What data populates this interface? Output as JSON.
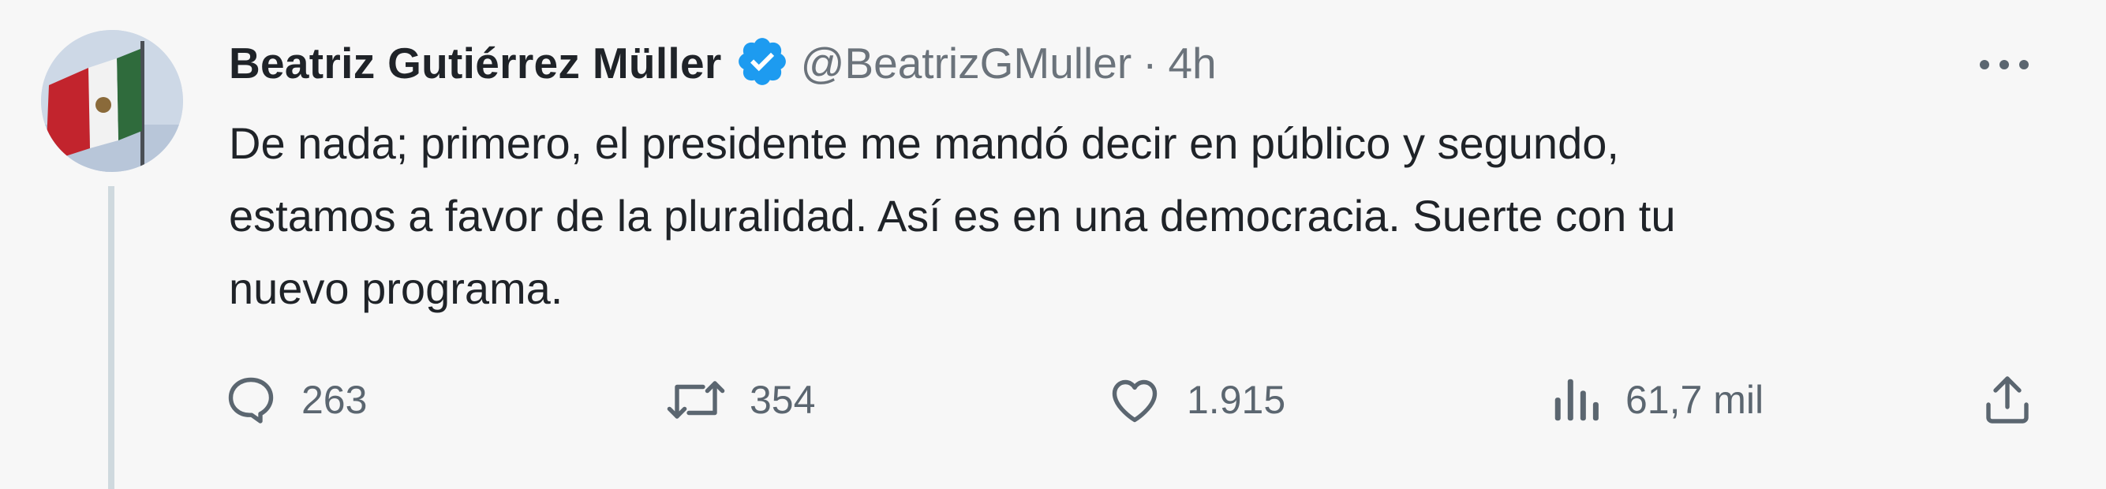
{
  "tweet": {
    "author_name": "Beatriz Gutiérrez Müller",
    "handle": "@BeatrizGMuller",
    "separator": "·",
    "time": "4h",
    "body_lines": [
      "De nada; primero, el presidente me mandó decir en público y segundo,",
      "estamos a favor de la pluralidad. Así es en una democracia. Suerte con tu",
      "nuevo programa."
    ],
    "verified": true
  },
  "actions": {
    "reply_count": "263",
    "retweet_count": "354",
    "like_count": "1.915",
    "views_count": "61,7 mil"
  },
  "icons": {
    "verified": "verified-badge-icon",
    "more": "more-dots-icon",
    "reply": "reply-icon",
    "retweet": "retweet-icon",
    "like": "heart-icon",
    "views": "views-icon",
    "share": "share-icon"
  },
  "colors": {
    "background": "#f7f7f7",
    "verified_blue": "#1d9bf0",
    "text": "#1f2328",
    "secondary_text": "#6b737b",
    "thread_line": "#cfd9de"
  }
}
